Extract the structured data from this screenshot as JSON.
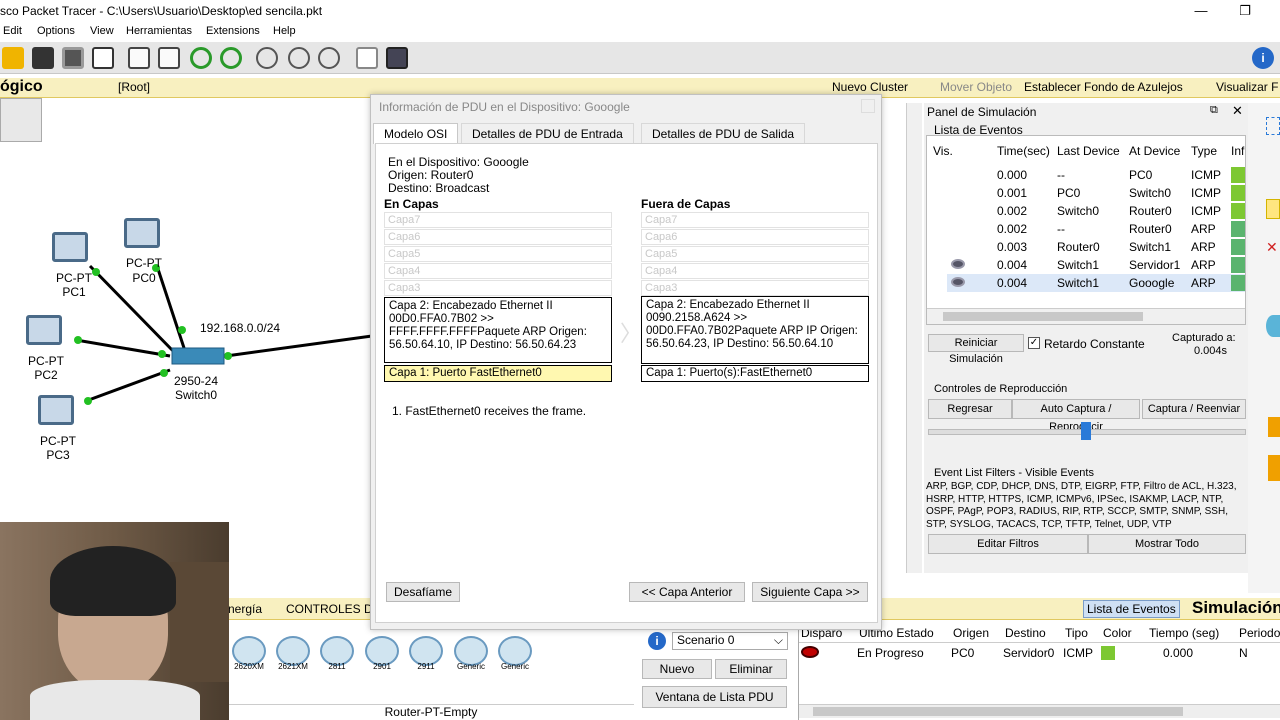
{
  "window": {
    "title": "sco Packet Tracer - C:\\Users\\Usuario\\Desktop\\ed sencila.pkt",
    "minimize": "—",
    "restore": "❐"
  },
  "menu": {
    "items": [
      "Edit",
      "Options",
      "View",
      "Herramientas",
      "Extensions",
      "Help"
    ]
  },
  "workbar": {
    "mode": "ógico",
    "root": "[Root]",
    "new_cluster": "Nuevo Cluster",
    "move_object": "Mover Objeto",
    "set_bg": "Establecer Fondo de Azulejos",
    "visualize": "Visualizar F"
  },
  "topology": {
    "pc1": {
      "type": "PC-PT",
      "name": "PC1"
    },
    "pc0": {
      "type": "PC-PT",
      "name": "PC0"
    },
    "pc2": {
      "type": "PC-PT",
      "name": "PC2"
    },
    "pc3": {
      "type": "PC-PT",
      "name": "PC3"
    },
    "switch": {
      "model": "2950-24",
      "name": "Switch0"
    },
    "network": "192.168.0.0/24"
  },
  "dialog": {
    "title": "Información de PDU en el Dispositivo: Gooogle",
    "tabs": [
      "Modelo OSI",
      "Detalles de PDU de Entrada",
      "Detalles de PDU de Salida"
    ],
    "device_line": "En el Dispositivo: Gooogle",
    "origin_line": "Origen: Router0",
    "dest_line": "Destino: Broadcast",
    "in_header": "En Capas",
    "out_header": "Fuera de Capas",
    "empty_layers": [
      "Capa7",
      "Capa6",
      "Capa5",
      "Capa4",
      "Capa3"
    ],
    "in_layer2": "Capa 2: Encabezado Ethernet II 00D0.FFA0.7B02 >> FFFF.FFFF.FFFFPaquete ARP Origen: 56.50.64.10, IP Destino: 56.50.64.23",
    "out_layer2": "Capa 2: Encabezado Ethernet II 0090.2158.A624 >> 00D0.FFA0.7B02Paquete ARP IP Origen: 56.50.64.23, IP Destino: 56.50.64.10",
    "in_layer1": "Capa 1: Puerto FastEthernet0",
    "out_layer1": "Capa 1: Puerto(s):FastEthernet0",
    "note": "1. FastEthernet0 receives the frame.",
    "challenge_btn": "Desafíame",
    "prev_btn": "<< Capa Anterior",
    "next_btn": "Siguiente Capa >>"
  },
  "sim": {
    "panel_title": "Panel de Simulación",
    "event_list_title": "Lista de Eventos",
    "columns": [
      "Vis.",
      "Time(sec)",
      "Last Device",
      "At Device",
      "Type",
      "Inf"
    ],
    "events": [
      {
        "time": "0.000",
        "last": "--",
        "at": "PC0",
        "type": "ICMP",
        "color": "#7dc832"
      },
      {
        "time": "0.001",
        "last": "PC0",
        "at": "Switch0",
        "type": "ICMP",
        "color": "#7dc832"
      },
      {
        "time": "0.002",
        "last": "Switch0",
        "at": "Router0",
        "type": "ICMP",
        "color": "#7dc832"
      },
      {
        "time": "0.002",
        "last": "--",
        "at": "Router0",
        "type": "ARP",
        "color": "#5ab46e"
      },
      {
        "time": "0.003",
        "last": "Router0",
        "at": "Switch1",
        "type": "ARP",
        "color": "#5ab46e"
      },
      {
        "time": "0.004",
        "last": "Switch1",
        "at": "Servidor1",
        "type": "ARP",
        "color": "#5ab46e"
      },
      {
        "time": "0.004",
        "last": "Switch1",
        "at": "Gooogle",
        "type": "ARP",
        "color": "#5ab46e"
      }
    ],
    "reset_btn": "Reiniciar Simulación",
    "constant_delay": "Retardo Constante",
    "captured_label": "Capturado a:",
    "captured_value": "0.004s",
    "playback_title": "Controles de Reproducción",
    "back_btn": "Regresar",
    "auto_btn": "Auto Captura / Reproducir",
    "capture_btn": "Captura / Reenviar",
    "filters_title": "Event List Filters - Visible Events",
    "filters_text": "ARP, BGP, CDP, DHCP, DNS, DTP, EIGRP, FTP, Filtro de ACL, H.323, HSRP, HTTP, HTTPS, ICMP, ICMPv6, IPSec, ISAKMP, LACP, NTP, OSPF, PAgP, POP3, RADIUS, RIP, RTP, SCCP, SMTP, SNMP, SSH, STP, SYSLOG, TACACS, TCP, TFTP, Telnet, UDP, VTP",
    "edit_filters": "Editar Filtros",
    "show_all": "Mostrar Todo"
  },
  "bottom": {
    "energy_tab": "nergía",
    "controls_tab": "CONTROLES D",
    "devices": [
      "2620XM",
      "2621XM",
      "2811",
      "2901",
      "2911",
      "Generic",
      "Generic"
    ],
    "device_label": "Router-PT-Empty",
    "scenario": "Scenario 0",
    "new_btn": "Nuevo",
    "delete_btn": "Eliminar",
    "pdu_list_btn": "Ventana de Lista PDU",
    "event_list_tab": "Lista de Eventos",
    "simulation_label": "Simulación",
    "pdu_columns": [
      "Disparo",
      "Último Estado",
      "Origen",
      "Destino",
      "Tipo",
      "Color",
      "Tiempo (seg)",
      "Periodo"
    ],
    "pdu_row": {
      "state": "En Progreso",
      "src": "PC0",
      "dst": "Servidor0",
      "type": "ICMP",
      "time": "0.000",
      "periodic": "N"
    }
  }
}
